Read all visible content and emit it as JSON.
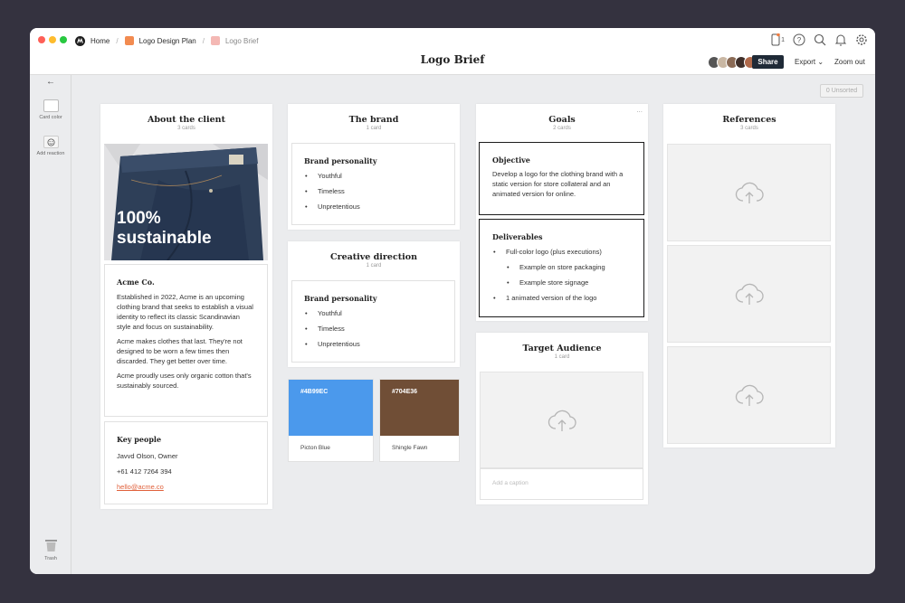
{
  "window": {
    "title": "Logo Brief"
  },
  "breadcrumbs": [
    "Home",
    "Logo Design Plan",
    "Logo Brief"
  ],
  "topbar": {
    "device_count": "1",
    "share_label": "Share",
    "export_label": "Export",
    "zoom_label": "Zoom out",
    "icons": [
      "devices-icon",
      "help-icon",
      "search-icon",
      "bell-icon",
      "gear-icon"
    ]
  },
  "sidebar": {
    "back_icon": "back-arrow-icon",
    "card_color_label": "Card color",
    "add_reaction_label": "Add reaction",
    "trash_label": "Trash"
  },
  "unsorted": {
    "count": "0",
    "label": "Unsorted"
  },
  "columns": {
    "client": {
      "title": "About the client",
      "subtitle": "3 cards",
      "image_text": "100%\nsustainable",
      "company_card": {
        "heading": "Acme Co.",
        "paragraphs": [
          "Established in 2022, Acme is an upcoming clothing brand that seeks to establish a visual identity to reflect its classic Scandinavian style and focus on sustainability.",
          "Acme makes clothes that last. They're not designed to be worn a few times then discarded. They get better over time.",
          "Acme proudly uses only organic cotton that's sustainably sourced."
        ]
      },
      "people_card": {
        "heading": "Key people",
        "lines": [
          "Javvd Olson, Owner",
          "+61 412 7264 394"
        ],
        "email": "hello@acme.co"
      }
    },
    "brand": {
      "title": "The brand",
      "subtitle": "1 card",
      "card": {
        "heading": "Brand personality",
        "items": [
          "Youthful",
          "Timeless",
          "Unpretentious"
        ]
      }
    },
    "creative": {
      "title": "Creative direction",
      "subtitle": "1 card",
      "card": {
        "heading": "Brand personality",
        "items": [
          "Youthful",
          "Timeless",
          "Unpretentious"
        ]
      }
    },
    "swatches": [
      {
        "hex": "#4B99EC",
        "name": "Picton Blue",
        "color": "#4b99ec"
      },
      {
        "hex": "#704E36",
        "name": "Shingle Fawn",
        "color": "#704e36"
      }
    ],
    "goals": {
      "title": "Goals",
      "subtitle": "2 cards",
      "more": "...",
      "objective": {
        "heading": "Objective",
        "text": "Develop a logo for the clothing brand with a static version for store collateral and an animated version for online."
      },
      "deliverables": {
        "heading": "Deliverables",
        "items": [
          {
            "text": "Full-color logo (plus executions)",
            "sub": false
          },
          {
            "text": "Example on store packaging",
            "sub": true
          },
          {
            "text": "Example store signage",
            "sub": true
          },
          {
            "text": "1 animated version of the logo",
            "sub": false
          }
        ]
      }
    },
    "audience": {
      "title": "Target Audience",
      "subtitle": "1 card",
      "caption_placeholder": "Add a caption"
    },
    "references": {
      "title": "References",
      "subtitle": "3 cards"
    }
  }
}
